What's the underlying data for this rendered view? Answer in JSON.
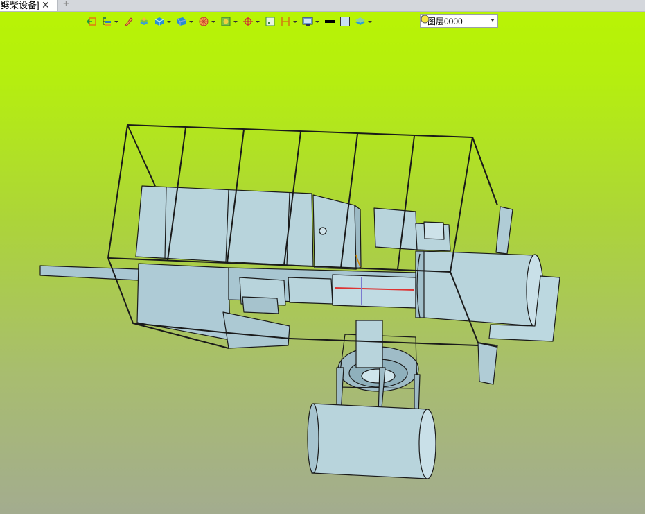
{
  "tab": {
    "title": "劈柴设备]",
    "close_glyph": "✕",
    "add_glyph": "+"
  },
  "toolbar": {
    "items": [
      {
        "name": "exit-sketch-icon"
      },
      {
        "name": "feature-tree-icon",
        "dropdown": true
      },
      {
        "name": "pencil-icon"
      },
      {
        "name": "stack-icon"
      },
      {
        "name": "solid-box-icon",
        "dropdown": true
      },
      {
        "name": "view-orient-icon",
        "dropdown": true
      },
      {
        "name": "render-mode-icon",
        "dropdown": true
      },
      {
        "name": "section-view-icon",
        "dropdown": true
      },
      {
        "name": "snap-target-icon",
        "dropdown": true
      },
      {
        "name": "frame-select-icon"
      },
      {
        "name": "dimension-icon",
        "dropdown": true
      },
      {
        "name": "display-settings-icon",
        "dropdown": true
      },
      {
        "name": "line-color-icon"
      },
      {
        "name": "fill-color-icon"
      },
      {
        "name": "layer-manager-icon",
        "dropdown": true
      }
    ],
    "layer": {
      "name": "图层0000"
    }
  },
  "colors": {
    "viewport_top": "#b8f404",
    "viewport_bottom": "#a3ac8f",
    "part_fill": "#b8d4dc",
    "edge": "#1a1a1a"
  }
}
